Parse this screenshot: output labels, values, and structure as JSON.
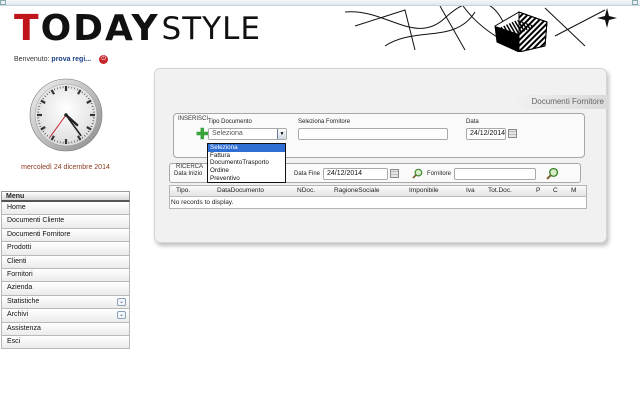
{
  "logo": {
    "first_letter": "T",
    "rest": "ODAY",
    "style": "STYLE"
  },
  "welcome": {
    "label": "Benvenuto:",
    "user": "prova regi..."
  },
  "date": "mercoledì 24 dicembre 2014",
  "menu": {
    "header": "Menu",
    "items": [
      {
        "label": "Home",
        "has_submenu": false
      },
      {
        "label": "Documenti Cliente",
        "has_submenu": false
      },
      {
        "label": "Documenti Fornitore",
        "has_submenu": false
      },
      {
        "label": "Prodotti",
        "has_submenu": false
      },
      {
        "label": "Clienti",
        "has_submenu": false
      },
      {
        "label": "Fornitori",
        "has_submenu": false
      },
      {
        "label": "Azienda",
        "has_submenu": false
      },
      {
        "label": "Statistiche",
        "has_submenu": true
      },
      {
        "label": "Archivi",
        "has_submenu": true
      },
      {
        "label": "Assistenza",
        "has_submenu": false
      },
      {
        "label": "Esci",
        "has_submenu": false
      }
    ]
  },
  "panel": {
    "title": "Documenti Fornitore",
    "inserisci": {
      "legend": "INSERISCI",
      "tipo_label": "Tipo Documento",
      "tipo_value": "Seleziona",
      "fornitore_label": "Seleziona Fornitore",
      "fornitore_value": "",
      "data_label": "Data",
      "data_value": "24/12/2014"
    },
    "dropdown_options": [
      "Seleziona",
      "Fattura",
      "DocumentoTrasporto",
      "Ordine",
      "Preventivo"
    ],
    "ricerca": {
      "legend": "RICERCA",
      "data_inizio_label": "Data Inizio",
      "data_fine_label": "Data Fine",
      "data_fine_value": "24/12/2014",
      "fornitore_label": "Fornitore",
      "fornitore_value": ""
    },
    "grid": {
      "columns": [
        "Tipo.",
        "DataDocumento",
        "NDoc.",
        "RagioneSociale",
        "Imponibile",
        "Iva",
        "Tot.Doc.",
        "P",
        "C",
        "M"
      ],
      "empty_text": "No records to display."
    }
  },
  "colors": {
    "accent_red": "#c0141c",
    "user_blue": "#1a3f86",
    "date_brown": "#8a3b1c",
    "select_blue": "#2f6fd3"
  },
  "clock": {
    "hour": 4,
    "minute": 24,
    "second": 36
  }
}
